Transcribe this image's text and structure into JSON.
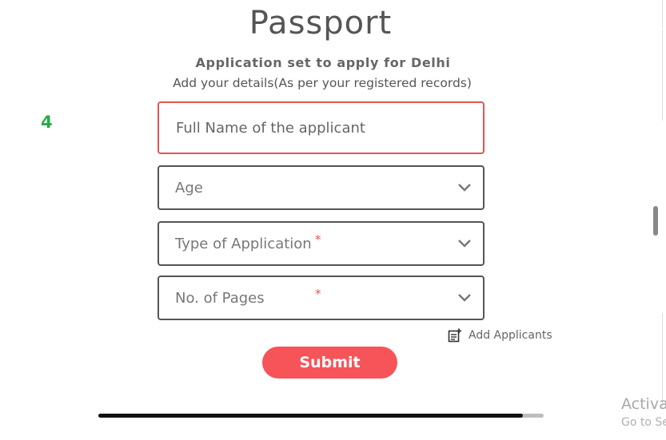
{
  "page": {
    "title": "Passport",
    "subtitle": "Application set to apply for Delhi",
    "details": "Add your details(As per your registered records)",
    "step": "4"
  },
  "form": {
    "full_name_placeholder": "Full Name of the applicant",
    "age_placeholder": "Age",
    "type_placeholder": "Type of Application",
    "pages_placeholder": "No. of Pages",
    "required_mark": "*",
    "add_applicants": "Add Applicants",
    "submit": "Submit"
  },
  "windows": {
    "activate_line1": "Activat",
    "activate_line2": "Go to Se"
  },
  "colors": {
    "accent": "#f65458",
    "step_green": "#2aa84a",
    "error_border": "#e05555"
  },
  "icons": {
    "select_chevron": "chevron-down-icon",
    "add_applicants": "note-add-icon"
  }
}
